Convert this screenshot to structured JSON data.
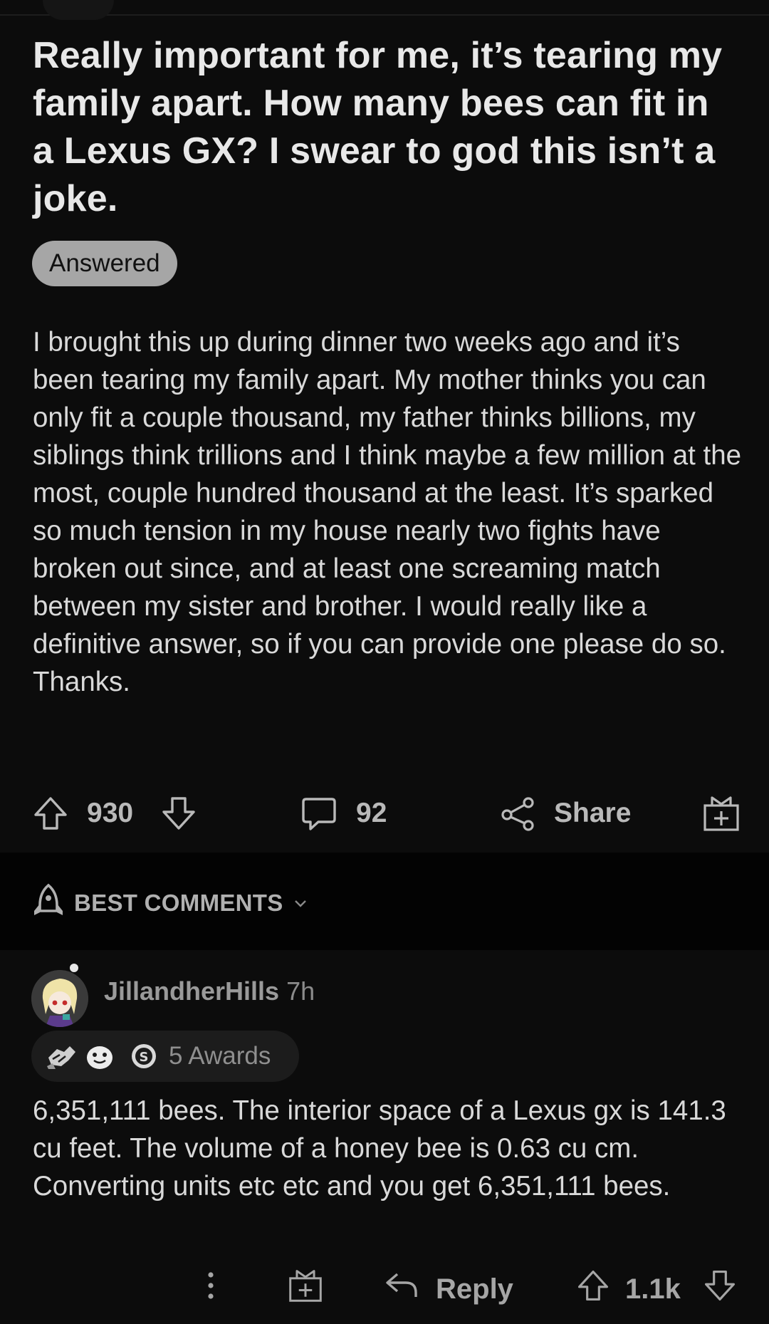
{
  "post": {
    "title": "Really important for me, it’s tearing my family apart. How many bees can fit in a Lexus GX? I swear to god this isn’t a joke.",
    "flair": "Answered",
    "body": "I brought this up during dinner two weeks ago and it’s been tearing my family apart. My mother thinks you can only fit a couple thousand, my father thinks billions, my siblings think trillions and I think maybe a few million at the most, couple hundred thousand at the least. It’s sparked so much tension in my house nearly two fights have broken out since, and at least one screaming match between my sister and brother. I would really like a definitive answer, so if you can provide one please do so. Thanks.",
    "actions": {
      "upvotes": "930",
      "comments": "92",
      "share_label": "Share"
    }
  },
  "comments_section": {
    "sort_label": "BEST COMMENTS"
  },
  "comment": {
    "username": "JillandherHills",
    "age": "7h",
    "awards_label": "5 Awards",
    "body": "6,351,111 bees. The interior space of a Lexus gx is 141.3 cu feet. The volume of a honey bee is 0.63 cu cm. Converting units etc etc and you get 6,351,111 bees.",
    "actions": {
      "reply_label": "Reply",
      "votes": "1.1k"
    }
  },
  "icons": {
    "upvote": "upvote-arrow-icon",
    "downvote": "downvote-arrow-icon",
    "comment": "speech-bubble-icon",
    "share": "share-icon",
    "award": "gift-icon",
    "sort": "rocket-icon",
    "more": "more-vertical-icon",
    "reply": "reply-arrow-icon"
  },
  "colors": {
    "background": "#0c0c0c",
    "section_band": "#030303",
    "flair_background": "#a6a6a6",
    "text": "#d9d9d9",
    "muted_text": "#9a9a9a"
  }
}
